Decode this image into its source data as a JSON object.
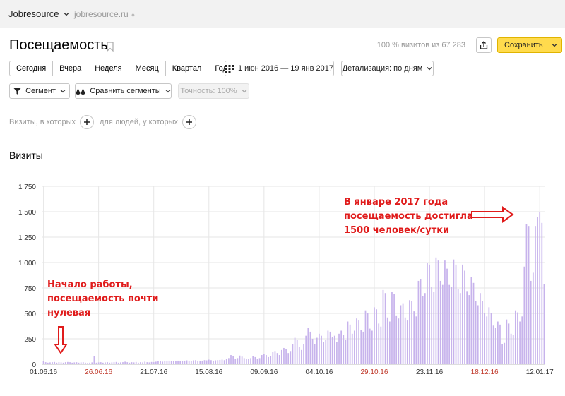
{
  "header": {
    "site_name": "Jobresource",
    "site_url": "jobresource.ru",
    "dot": "●"
  },
  "page": {
    "title": "Посещаемость",
    "visits_share": "100 % визитов из 67 283",
    "save_label": "Сохранить"
  },
  "periods": [
    "Сегодня",
    "Вчера",
    "Неделя",
    "Месяц",
    "Квартал",
    "Год"
  ],
  "controls": {
    "date_range": "1 июн 2016 — 19 янв 2017",
    "detail": "Детализация: по дням",
    "segment": "Сегмент",
    "compare": "Сравнить сегменты",
    "accuracy": "Точность: 100%"
  },
  "filters": {
    "visits_which": "Визиты, в которых",
    "people_which": "для людей, у которых"
  },
  "chart_title": "Визиты",
  "annotations": {
    "left": [
      "Начало работы,",
      "посещаемость почти",
      "нулевая"
    ],
    "right": [
      "В январе 2017 года",
      "посещаемость достигла",
      "1500 человек/сутки"
    ]
  },
  "colors": {
    "accent_yellow": "#ffdb4d",
    "bar_color": "#c7b3ec",
    "annotation_red": "#e01b1b",
    "weekend_tick": "#c0392b"
  },
  "chart_data": {
    "type": "bar",
    "title": "Визиты",
    "xlabel": "",
    "ylabel": "",
    "ylim": [
      0,
      1750
    ],
    "yticks": [
      0,
      250,
      500,
      750,
      1000,
      1250,
      1500,
      1750
    ],
    "ytick_labels": [
      "0",
      "250",
      "500",
      "750",
      "1 000",
      "1 250",
      "1 500",
      "1 750"
    ],
    "xticks": [
      {
        "label": "01.06.16",
        "day": 0,
        "color": "#333"
      },
      {
        "label": "26.06.16",
        "day": 25,
        "color": "#c0392b"
      },
      {
        "label": "21.07.16",
        "day": 50,
        "color": "#333"
      },
      {
        "label": "15.08.16",
        "day": 75,
        "color": "#333"
      },
      {
        "label": "09.09.16",
        "day": 100,
        "color": "#333"
      },
      {
        "label": "04.10.16",
        "day": 125,
        "color": "#333"
      },
      {
        "label": "29.10.16",
        "day": 150,
        "color": "#c0392b"
      },
      {
        "label": "23.11.16",
        "day": 175,
        "color": "#333"
      },
      {
        "label": "18.12.16",
        "day": 200,
        "color": "#c0392b"
      },
      {
        "label": "12.01.17",
        "day": 225,
        "color": "#333"
      }
    ],
    "series": [
      {
        "values": [
          30,
          20,
          15,
          18,
          20,
          22,
          15,
          20,
          18,
          15,
          20,
          22,
          20,
          15,
          18,
          20,
          15,
          18,
          20,
          15,
          12,
          15,
          18,
          80,
          15,
          18,
          20,
          15,
          18,
          20,
          15,
          18,
          20,
          22,
          15,
          18,
          20,
          25,
          20,
          15,
          20,
          18,
          22,
          15,
          20,
          18,
          25,
          20,
          18,
          22,
          20,
          25,
          28,
          30,
          25,
          30,
          28,
          35,
          30,
          32,
          30,
          35,
          32,
          30,
          35,
          38,
          35,
          30,
          38,
          40,
          35,
          30,
          35,
          40,
          38,
          45,
          40,
          35,
          38,
          40,
          42,
          45,
          40,
          50,
          60,
          90,
          80,
          55,
          60,
          85,
          75,
          60,
          55,
          50,
          60,
          80,
          70,
          55,
          60,
          90,
          100,
          90,
          70,
          80,
          120,
          130,
          110,
          90,
          140,
          160,
          150,
          110,
          130,
          200,
          260,
          240,
          170,
          140,
          200,
          280,
          360,
          320,
          250,
          200,
          260,
          300,
          280,
          220,
          240,
          330,
          320,
          270,
          280,
          220,
          300,
          330,
          290,
          240,
          420,
          390,
          300,
          330,
          450,
          430,
          340,
          320,
          530,
          500,
          350,
          330,
          560,
          540,
          400,
          370,
          730,
          700,
          460,
          420,
          710,
          690,
          480,
          450,
          580,
          600,
          460,
          430,
          630,
          620,
          520,
          470,
          820,
          840,
          670,
          700,
          1000,
          980,
          760,
          710,
          1050,
          1020,
          820,
          780,
          1020,
          940,
          780,
          760,
          1030,
          980,
          740,
          700,
          980,
          920,
          720,
          680,
          860,
          800,
          620,
          580,
          700,
          620,
          500,
          470,
          560,
          500,
          380,
          360,
          420,
          390,
          200,
          210,
          440,
          400,
          300,
          290,
          530,
          510,
          420,
          470,
          960,
          1380,
          1360,
          820,
          900,
          1360,
          1450,
          1500,
          1390,
          790
        ]
      }
    ]
  }
}
